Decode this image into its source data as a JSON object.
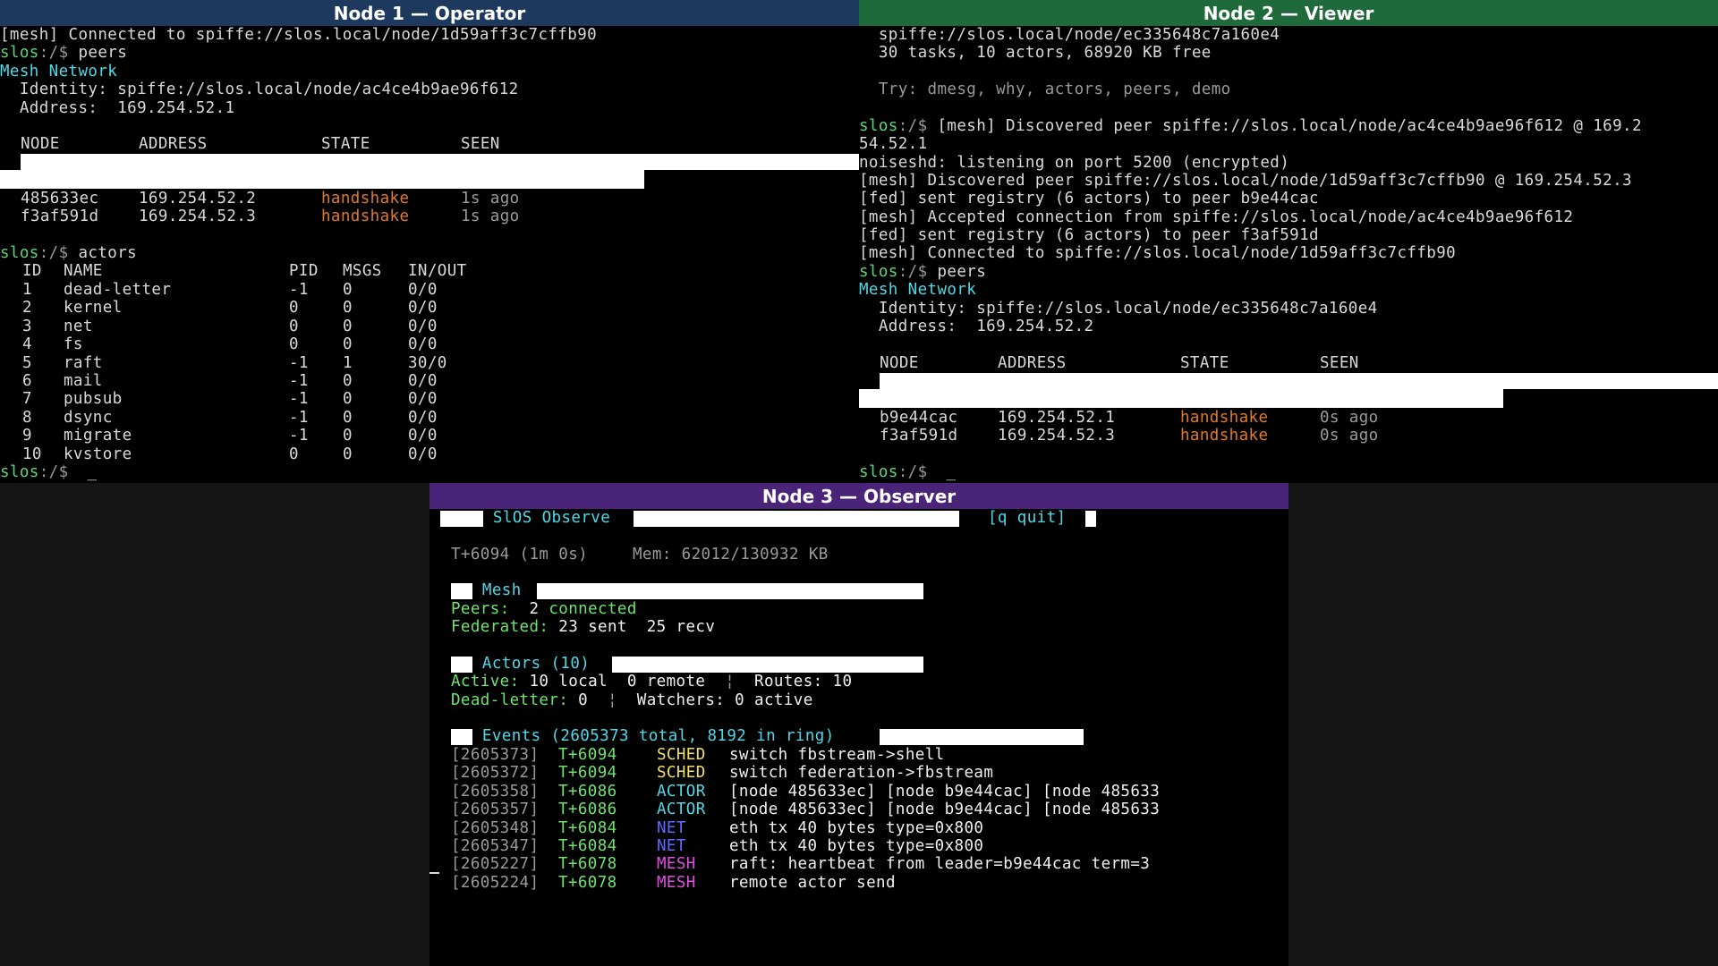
{
  "node1": {
    "title": "Node 1 — Operator",
    "title_color": "#1d3a5e",
    "lines": {
      "l1": "[mesh] Connected to spiffe://slos.local/node/1d59aff3c7cffb90",
      "p1": "slos",
      "p1_path": ":/$ ",
      "p1_cmd": "peers",
      "mesh_header": "Mesh Network",
      "identity": "  Identity: spiffe://slos.local/node/ac4ce4b9ae96f612",
      "address": "  Address:  169.254.52.1"
    },
    "peers_header": {
      "node": "NODE",
      "address": "ADDRESS",
      "state": "STATE",
      "seen": "SEEN"
    },
    "peers": [
      {
        "node": "485633ec",
        "address": "169.254.52.2",
        "state": "handshake",
        "seen": "1s ago"
      },
      {
        "node": "f3af591d",
        "address": "169.254.52.3",
        "state": "handshake",
        "seen": "1s ago"
      }
    ],
    "p2": "slos",
    "p2_path": ":/$ ",
    "p2_cmd": "actors",
    "actors_header": {
      "id": "ID",
      "name": "NAME",
      "pid": "PID",
      "msgs": "MSGS",
      "io": "IN/OUT"
    },
    "actors": [
      {
        "id": "1",
        "name": "dead-letter",
        "pid": "-1",
        "msgs": "0",
        "io": "0/0"
      },
      {
        "id": "2",
        "name": "kernel",
        "pid": "0",
        "msgs": "0",
        "io": "0/0"
      },
      {
        "id": "3",
        "name": "net",
        "pid": "0",
        "msgs": "0",
        "io": "0/0"
      },
      {
        "id": "4",
        "name": "fs",
        "pid": "0",
        "msgs": "0",
        "io": "0/0"
      },
      {
        "id": "5",
        "name": "raft",
        "pid": "-1",
        "msgs": "1",
        "io": "30/0"
      },
      {
        "id": "6",
        "name": "mail",
        "pid": "-1",
        "msgs": "0",
        "io": "0/0"
      },
      {
        "id": "7",
        "name": "pubsub",
        "pid": "-1",
        "msgs": "0",
        "io": "0/0"
      },
      {
        "id": "8",
        "name": "dsync",
        "pid": "-1",
        "msgs": "0",
        "io": "0/0"
      },
      {
        "id": "9",
        "name": "migrate",
        "pid": "-1",
        "msgs": "0",
        "io": "0/0"
      },
      {
        "id": "10",
        "name": "kvstore",
        "pid": "0",
        "msgs": "0",
        "io": "0/0"
      }
    ],
    "p3": "slos",
    "p3_path": ":/$ ",
    "cursor": "_"
  },
  "node2": {
    "title": "Node 2 — Viewer",
    "title_color": "#1f6a3a",
    "l1": "  spiffe://slos.local/node/ec335648c7a160e4",
    "l2": "  30 tasks, 10 actors, 68920 KB free",
    "l3": "  Try: dmesg, why, actors, peers, demo",
    "p1": "slos",
    "p1_path": ":/$ ",
    "l4": "[mesh] Discovered peer spiffe://slos.local/node/ac4ce4b9ae96f612 @ 169.2",
    "l5": "54.52.1",
    "l6": "noiseshd: listening on port 5200 (encrypted)",
    "l7": "[mesh] Discovered peer spiffe://slos.local/node/1d59aff3c7cffb90 @ 169.254.52.3",
    "l8": "[fed] sent registry (6 actors) to peer b9e44cac",
    "l9": "[mesh] Accepted connection from spiffe://slos.local/node/ac4ce4b9ae96f612",
    "l10": "[fed] sent registry (6 actors) to peer f3af591d",
    "l11": "[mesh] Connected to spiffe://slos.local/node/1d59aff3c7cffb90",
    "p2": "slos",
    "p2_path": ":/$ ",
    "p2_cmd": "peers",
    "mesh_header": "Mesh Network",
    "identity": "  Identity: spiffe://slos.local/node/ec335648c7a160e4",
    "address": "  Address:  169.254.52.2",
    "peers_header": {
      "node": "NODE",
      "address": "ADDRESS",
      "state": "STATE",
      "seen": "SEEN"
    },
    "peers": [
      {
        "node": "b9e44cac",
        "address": "169.254.52.1",
        "state": "handshake",
        "seen": "0s ago"
      },
      {
        "node": "f3af591d",
        "address": "169.254.52.3",
        "state": "handshake",
        "seen": "0s ago"
      }
    ],
    "p3": "slos",
    "p3_path": ":/$ ",
    "cursor": "_"
  },
  "node3": {
    "title": "Node 3 — Observer",
    "title_color": "#4a2478",
    "app_title": " SlOS Observe ",
    "quit": "[q quit]",
    "status_time": "T+6094 (1m 0s)",
    "status_mem": "Mem: 62012/130932 KB",
    "mesh": {
      "header": " Mesh ",
      "peers_label": "Peers:",
      "peers_count": "2",
      "peers_state": "connected",
      "fed_label": "Federated:",
      "fed_value": "23 sent  25 recv"
    },
    "actors": {
      "header": " Actors (10) ",
      "active_label": "Active:",
      "active_value": "10 local  0 remote",
      "sep": "¦",
      "routes": "Routes: 10",
      "dl_label": "Dead-letter:",
      "dl_value": "0",
      "watchers": "Watchers: 0 active"
    },
    "events": {
      "header": " Events (2605373 total, 8192 in ring) ",
      "rows": [
        {
          "id": "[2605373]",
          "t": "T+6094",
          "kind": "SCHED",
          "msg": "switch fbstream->shell"
        },
        {
          "id": "[2605372]",
          "t": "T+6094",
          "kind": "SCHED",
          "msg": "switch federation->fbstream"
        },
        {
          "id": "[2605358]",
          "t": "T+6086",
          "kind": "ACTOR",
          "msg": "[node 485633ec] [node b9e44cac] [node 485633"
        },
        {
          "id": "[2605357]",
          "t": "T+6086",
          "kind": "ACTOR",
          "msg": "[node 485633ec] [node b9e44cac] [node 485633"
        },
        {
          "id": "[2605348]",
          "t": "T+6084",
          "kind": "NET",
          "msg": "eth tx 40 bytes type=0x800"
        },
        {
          "id": "[2605347]",
          "t": "T+6084",
          "kind": "NET",
          "msg": "eth tx 40 bytes type=0x800"
        },
        {
          "id": "[2605227]",
          "t": "T+6078",
          "kind": "MESH",
          "msg": "raft: heartbeat from leader=b9e44cac term=3"
        },
        {
          "id": "[2605224]",
          "t": "T+6078",
          "kind": "MESH",
          "msg": "remote actor send"
        }
      ]
    },
    "cursor": "_"
  }
}
